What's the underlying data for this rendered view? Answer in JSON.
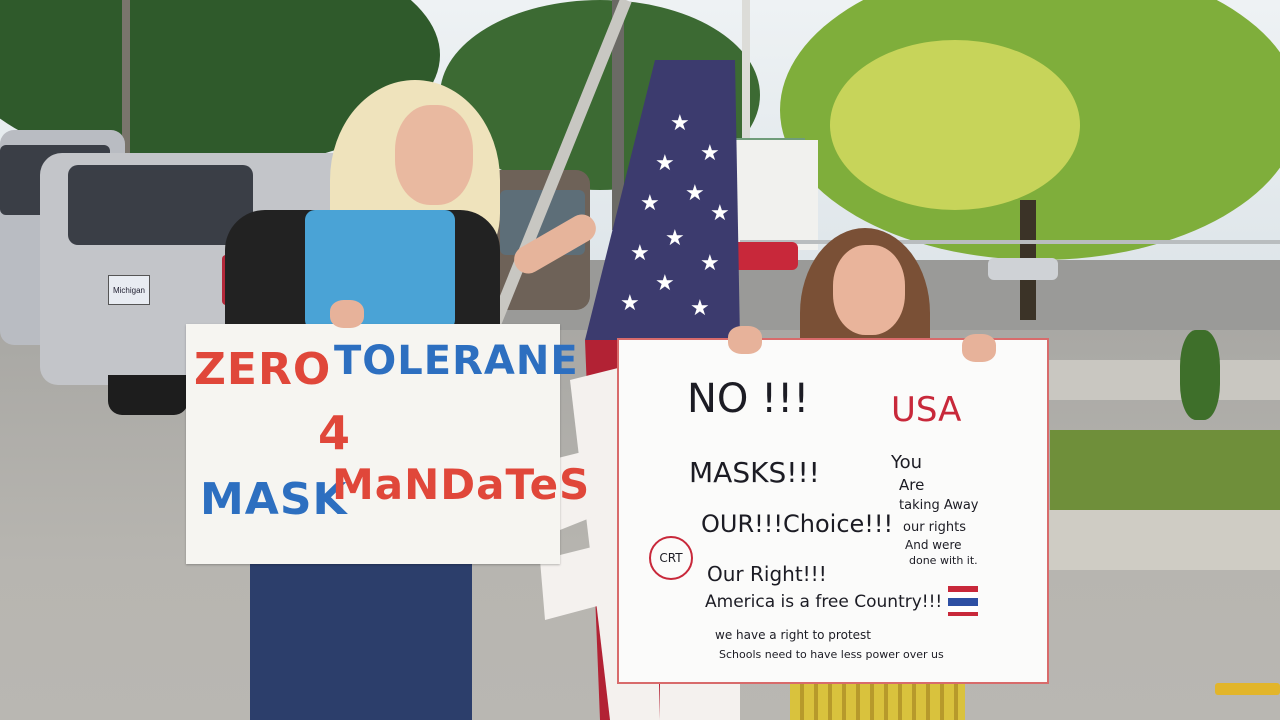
{
  "scene": {
    "sign_left": {
      "line1a": "ZERO",
      "line1b": "TOLERANE",
      "line2": "4",
      "line3a": "MASK",
      "line3b": "MaNDaTeS"
    },
    "sign_right": {
      "no": "NO !!!",
      "usa": "USA",
      "masks": "MASKS!!!",
      "choice": "OUR!!!Choice!!!",
      "crt": "CRT",
      "right": "Our Right!!!",
      "free_country": "America is a free Country!!!",
      "protest": "we have a right to protest",
      "schools": "Schools need to have less power over us",
      "you": "You",
      "are": "Are",
      "taking": "taking Away",
      "rights": "our rights",
      "and_were": "And were",
      "done": "done with it."
    },
    "plate_text": "Michigan",
    "colors": {
      "flag_red": "#b22234",
      "flag_blue": "#3c3b6e",
      "sign_red": "#e0473a",
      "sign_blue": "#2d6fc0"
    }
  }
}
